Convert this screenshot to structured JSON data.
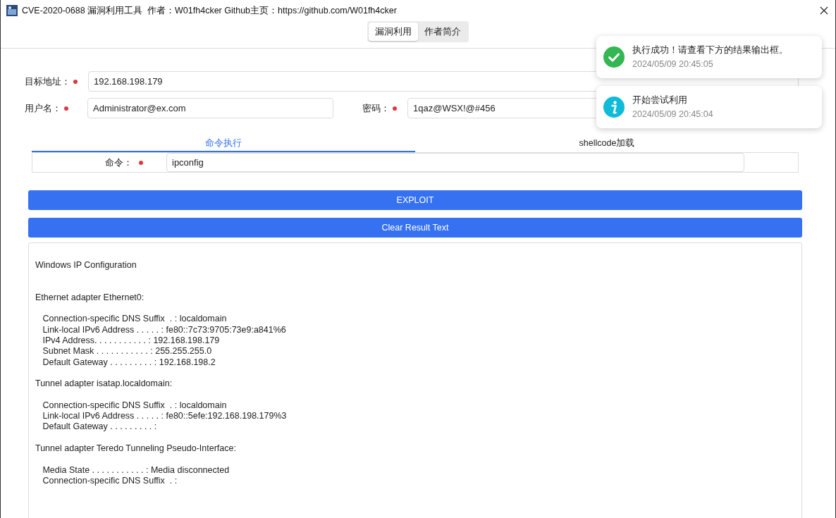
{
  "window": {
    "title": "CVE-2020-0688 漏洞利用工具  作者：W01fh4cker Github主页：https://github.com/W01fh4cker"
  },
  "top_tabs": [
    {
      "label": "漏洞利用",
      "selected": true
    },
    {
      "label": "作者简介",
      "selected": false
    }
  ],
  "form": {
    "target": {
      "label": "目标地址：",
      "required": true,
      "value": "192.168.198.179"
    },
    "username": {
      "label": "用户名：",
      "required": true,
      "value": "Administrator@ex.com"
    },
    "password": {
      "label": "密码：",
      "required": true,
      "value": "1qaz@WSX!@#456"
    }
  },
  "sub_tabs": [
    {
      "label": "命令执行",
      "selected": true
    },
    {
      "label": "shellcode加载",
      "selected": false
    }
  ],
  "command": {
    "label": "命令：",
    "required": true,
    "value": "ipconfig"
  },
  "buttons": [
    "EXPLOIT",
    "Clear Result Text"
  ],
  "output": "Windows IP Configuration\n\n\nEthernet adapter Ethernet0:\n\n   Connection-specific DNS Suffix  . : localdomain\n   Link-local IPv6 Address . . . . . : fe80::7c73:9705:73e9:a841%6\n   IPv4 Address. . . . . . . . . . . : 192.168.198.179\n   Subnet Mask . . . . . . . . . . . : 255.255.255.0\n   Default Gateway . . . . . . . . . : 192.168.198.2\n\nTunnel adapter isatap.localdomain:\n\n   Connection-specific DNS Suffix  . : localdomain\n   Link-local IPv6 Address . . . . . : fe80::5efe:192.168.198.179%3\n   Default Gateway . . . . . . . . . :\n\nTunnel adapter Teredo Tunneling Pseudo-Interface:\n\n   Media State . . . . . . . . . . . : Media disconnected\n   Connection-specific DNS Suffix  . :",
  "notifications": [
    {
      "kind": "success",
      "message": "执行成功！请查看下方的结果输出框。",
      "time": "2024/05/09 20:45:05"
    },
    {
      "kind": "info",
      "message": "开始尝试利用",
      "time": "2024/05/09 20:45:04"
    }
  ]
}
